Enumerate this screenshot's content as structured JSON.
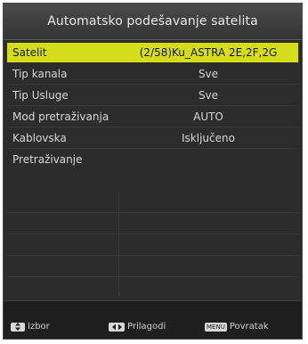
{
  "header": {
    "title": "Automatsko podešavanje satelita"
  },
  "rows": [
    {
      "label": "Satelit",
      "value": "(2/58)Ku_ASTRA 2E,2F,2G",
      "selected": true
    },
    {
      "label": "Tip kanala",
      "value": "Sve"
    },
    {
      "label": "Tip Usluge",
      "value": "Sve"
    },
    {
      "label": "Mod pretraživanja",
      "value": "AUTO"
    },
    {
      "label": "Kablovska",
      "value": "Isključeno"
    },
    {
      "label": "Pretraživanje",
      "value": ""
    }
  ],
  "footer": {
    "select": {
      "label": "Izbor",
      "key_icon": "up-down-arrows-icon"
    },
    "adjust": {
      "label": "Prilagodi",
      "key_icon": "left-right-arrows-icon"
    },
    "back": {
      "label": "Povratak",
      "key_icon": "menu-key-icon",
      "key_text": "MENU"
    }
  },
  "colors": {
    "selection": "#d4dc1b",
    "background": "#2c2c2c",
    "header": "#3e3e3e"
  }
}
